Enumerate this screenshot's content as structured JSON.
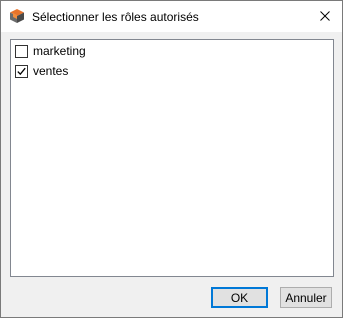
{
  "window": {
    "title": "Sélectionner les rôles autorisés",
    "icon": "app-cube-icon",
    "close_icon": "close-icon"
  },
  "roles": {
    "items": [
      {
        "label": "marketing",
        "checked": false
      },
      {
        "label": "ventes",
        "checked": true
      }
    ]
  },
  "buttons": {
    "ok_label": "OK",
    "cancel_label": "Annuler"
  },
  "colors": {
    "accent": "#0078d7",
    "app_icon_orange": "#e8742b",
    "app_icon_gray": "#6b6b6b"
  }
}
